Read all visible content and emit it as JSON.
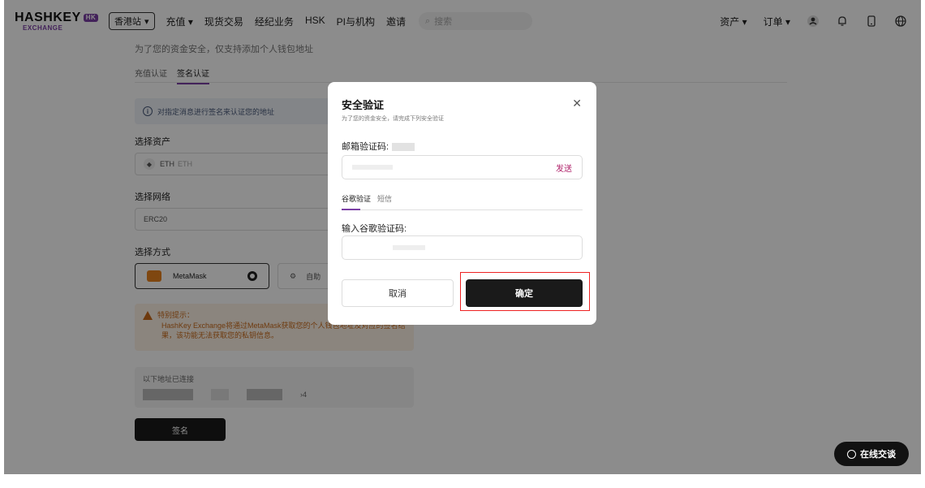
{
  "nav": {
    "logo_main": "HASHKEY",
    "logo_badge": "HK",
    "logo_sub": "EXCHANGE",
    "region": "香港站",
    "items": [
      "充值",
      "现货交易",
      "经纪业务",
      "HSK",
      "PI与机构",
      "邀请"
    ],
    "dropdown_indices": [
      0
    ],
    "search_placeholder": "搜索",
    "right": {
      "assets": "资产",
      "orders": "订单"
    }
  },
  "page": {
    "partial_notice": "为了您的资金安全，仅支持添加个人钱包地址",
    "tabs": [
      "充值认证",
      "签名认证"
    ],
    "active_tab": 1,
    "info_text": "对指定消息进行签名来认证您的地址",
    "asset_label": "选择资产",
    "asset_symbol": "ETH",
    "asset_name": "ETH",
    "network_label": "选择网络",
    "network_value": "ERC20",
    "method_label": "选择方式",
    "method_metamask": "MetaMask",
    "method_self": "自助",
    "warning_title": "特别提示：",
    "warning_body": "HashKey Exchange将通过MetaMask获取您的个人钱包地址及对应的签名结果，该功能无法获取您的私钥信息。",
    "connected_label": "以下地址已连接",
    "address_tail": "›4",
    "sign_button": "签名"
  },
  "modal": {
    "title": "安全验证",
    "subtitle": "为了您的资金安全，请完成下列安全验证",
    "email_label": "邮箱验证码:",
    "send_label": "发送",
    "tabs": [
      "谷歌验证",
      "短信"
    ],
    "active_tab": 0,
    "google_label": "输入谷歌验证码:",
    "cancel": "取消",
    "confirm": "确定"
  },
  "chat_button": "在线交谈",
  "colors": {
    "accent": "#7b3fa5",
    "highlight": "#e22222",
    "send": "#b0226a",
    "warning": "#c96a1a"
  }
}
